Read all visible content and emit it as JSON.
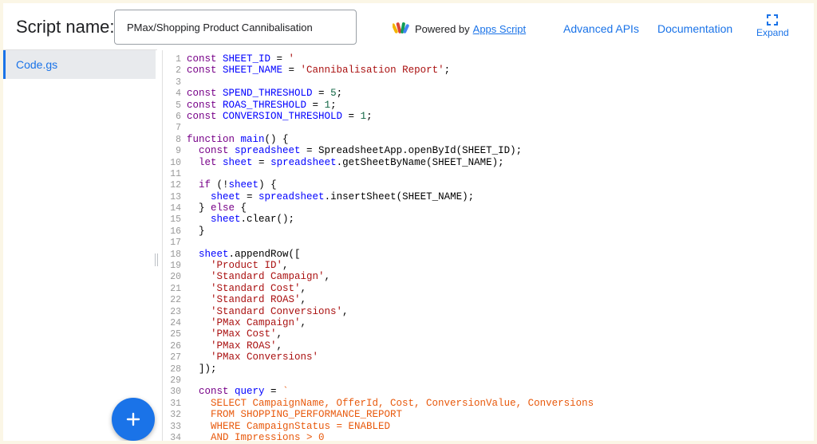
{
  "header": {
    "script_name_label": "Script name:",
    "script_name_value": "PMax/Shopping Product Cannibalisation",
    "powered_by_text": "Powered by",
    "powered_by_link": "Apps Script",
    "advanced_apis_link": "Advanced APIs",
    "documentation_link": "Documentation",
    "expand_label": "Expand"
  },
  "sidebar": {
    "files": [
      {
        "label": "Code.gs",
        "selected": true
      }
    ]
  },
  "editor": {
    "lines": [
      {
        "n": "1",
        "tokens": [
          {
            "t": "const ",
            "c": "kw"
          },
          {
            "t": "SHEET_ID",
            "c": "def"
          },
          {
            "t": " = ",
            "c": "pl"
          },
          {
            "t": "'",
            "c": "str"
          }
        ]
      },
      {
        "n": "2",
        "tokens": [
          {
            "t": "const ",
            "c": "kw"
          },
          {
            "t": "SHEET_NAME",
            "c": "def"
          },
          {
            "t": " = ",
            "c": "pl"
          },
          {
            "t": "'Cannibalisation Report'",
            "c": "str"
          },
          {
            "t": ";",
            "c": "pl"
          }
        ]
      },
      {
        "n": "3",
        "tokens": []
      },
      {
        "n": "4",
        "tokens": [
          {
            "t": "const ",
            "c": "kw"
          },
          {
            "t": "SPEND_THRESHOLD",
            "c": "def"
          },
          {
            "t": " = ",
            "c": "pl"
          },
          {
            "t": "5",
            "c": "num"
          },
          {
            "t": ";",
            "c": "pl"
          }
        ]
      },
      {
        "n": "5",
        "tokens": [
          {
            "t": "const ",
            "c": "kw"
          },
          {
            "t": "ROAS_THRESHOLD",
            "c": "def"
          },
          {
            "t": " = ",
            "c": "pl"
          },
          {
            "t": "1",
            "c": "num"
          },
          {
            "t": ";",
            "c": "pl"
          }
        ]
      },
      {
        "n": "6",
        "tokens": [
          {
            "t": "const ",
            "c": "kw"
          },
          {
            "t": "CONVERSION_THRESHOLD",
            "c": "def"
          },
          {
            "t": " = ",
            "c": "pl"
          },
          {
            "t": "1",
            "c": "num"
          },
          {
            "t": ";",
            "c": "pl"
          }
        ]
      },
      {
        "n": "7",
        "tokens": []
      },
      {
        "n": "8",
        "tokens": [
          {
            "t": "function ",
            "c": "kw"
          },
          {
            "t": "main",
            "c": "def"
          },
          {
            "t": "() {",
            "c": "pl"
          }
        ]
      },
      {
        "n": "9",
        "tokens": [
          {
            "t": "  ",
            "c": "pl"
          },
          {
            "t": "const ",
            "c": "kw"
          },
          {
            "t": "spreadsheet",
            "c": "def"
          },
          {
            "t": " = SpreadsheetApp.openById(SHEET_ID);",
            "c": "pl"
          }
        ]
      },
      {
        "n": "10",
        "tokens": [
          {
            "t": "  ",
            "c": "pl"
          },
          {
            "t": "let ",
            "c": "kw"
          },
          {
            "t": "sheet",
            "c": "def"
          },
          {
            "t": " = ",
            "c": "pl"
          },
          {
            "t": "spreadsheet",
            "c": "def"
          },
          {
            "t": ".getSheetByName(SHEET_NAME);",
            "c": "pl"
          }
        ]
      },
      {
        "n": "11",
        "tokens": []
      },
      {
        "n": "12",
        "tokens": [
          {
            "t": "  ",
            "c": "pl"
          },
          {
            "t": "if",
            "c": "kw"
          },
          {
            "t": " (!",
            "c": "pl"
          },
          {
            "t": "sheet",
            "c": "def"
          },
          {
            "t": ") {",
            "c": "pl"
          }
        ]
      },
      {
        "n": "13",
        "tokens": [
          {
            "t": "    ",
            "c": "pl"
          },
          {
            "t": "sheet",
            "c": "def"
          },
          {
            "t": " = ",
            "c": "pl"
          },
          {
            "t": "spreadsheet",
            "c": "def"
          },
          {
            "t": ".insertSheet(SHEET_NAME);",
            "c": "pl"
          }
        ]
      },
      {
        "n": "14",
        "tokens": [
          {
            "t": "  } ",
            "c": "pl"
          },
          {
            "t": "else",
            "c": "kw"
          },
          {
            "t": " {",
            "c": "pl"
          }
        ]
      },
      {
        "n": "15",
        "tokens": [
          {
            "t": "    ",
            "c": "pl"
          },
          {
            "t": "sheet",
            "c": "def"
          },
          {
            "t": ".clear();",
            "c": "pl"
          }
        ]
      },
      {
        "n": "16",
        "tokens": [
          {
            "t": "  }",
            "c": "pl"
          }
        ]
      },
      {
        "n": "17",
        "tokens": []
      },
      {
        "n": "18",
        "tokens": [
          {
            "t": "  ",
            "c": "pl"
          },
          {
            "t": "sheet",
            "c": "def"
          },
          {
            "t": ".appendRow([",
            "c": "pl"
          }
        ]
      },
      {
        "n": "19",
        "tokens": [
          {
            "t": "    ",
            "c": "pl"
          },
          {
            "t": "'Product ID'",
            "c": "str"
          },
          {
            "t": ",",
            "c": "pl"
          }
        ]
      },
      {
        "n": "20",
        "tokens": [
          {
            "t": "    ",
            "c": "pl"
          },
          {
            "t": "'Standard Campaign'",
            "c": "str"
          },
          {
            "t": ",",
            "c": "pl"
          }
        ]
      },
      {
        "n": "21",
        "tokens": [
          {
            "t": "    ",
            "c": "pl"
          },
          {
            "t": "'Standard Cost'",
            "c": "str"
          },
          {
            "t": ",",
            "c": "pl"
          }
        ]
      },
      {
        "n": "22",
        "tokens": [
          {
            "t": "    ",
            "c": "pl"
          },
          {
            "t": "'Standard ROAS'",
            "c": "str"
          },
          {
            "t": ",",
            "c": "pl"
          }
        ]
      },
      {
        "n": "23",
        "tokens": [
          {
            "t": "    ",
            "c": "pl"
          },
          {
            "t": "'Standard Conversions'",
            "c": "str"
          },
          {
            "t": ",",
            "c": "pl"
          }
        ]
      },
      {
        "n": "24",
        "tokens": [
          {
            "t": "    ",
            "c": "pl"
          },
          {
            "t": "'PMax Campaign'",
            "c": "str"
          },
          {
            "t": ",",
            "c": "pl"
          }
        ]
      },
      {
        "n": "25",
        "tokens": [
          {
            "t": "    ",
            "c": "pl"
          },
          {
            "t": "'PMax Cost'",
            "c": "str"
          },
          {
            "t": ",",
            "c": "pl"
          }
        ]
      },
      {
        "n": "26",
        "tokens": [
          {
            "t": "    ",
            "c": "pl"
          },
          {
            "t": "'PMax ROAS'",
            "c": "str"
          },
          {
            "t": ",",
            "c": "pl"
          }
        ]
      },
      {
        "n": "27",
        "tokens": [
          {
            "t": "    ",
            "c": "pl"
          },
          {
            "t": "'PMax Conversions'",
            "c": "str"
          }
        ]
      },
      {
        "n": "28",
        "tokens": [
          {
            "t": "  ]);",
            "c": "pl"
          }
        ]
      },
      {
        "n": "29",
        "tokens": []
      },
      {
        "n": "30",
        "tokens": [
          {
            "t": "  ",
            "c": "pl"
          },
          {
            "t": "const ",
            "c": "kw"
          },
          {
            "t": "query",
            "c": "def"
          },
          {
            "t": " = ",
            "c": "pl"
          },
          {
            "t": "`",
            "c": "tpl"
          }
        ]
      },
      {
        "n": "31",
        "tokens": [
          {
            "t": "    SELECT CampaignName, OfferId, Cost, ConversionValue, Conversions",
            "c": "tpl"
          }
        ]
      },
      {
        "n": "32",
        "tokens": [
          {
            "t": "    FROM SHOPPING_PERFORMANCE_REPORT",
            "c": "tpl"
          }
        ]
      },
      {
        "n": "33",
        "tokens": [
          {
            "t": "    WHERE CampaignStatus = ENABLED",
            "c": "tpl"
          }
        ]
      },
      {
        "n": "34",
        "tokens": [
          {
            "t": "    AND Impressions > 0",
            "c": "tpl"
          }
        ]
      }
    ]
  },
  "fab": {
    "icon": "plus-icon"
  },
  "colors": {
    "accent": "#1a73e8",
    "background": "#fbf6e6"
  }
}
